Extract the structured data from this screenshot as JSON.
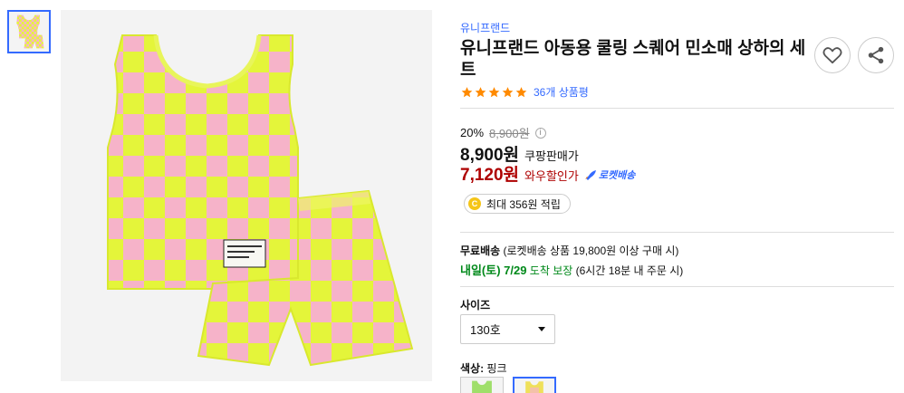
{
  "product": {
    "brand": "유니프랜드",
    "title": "유니프랜드 아동용 쿨링 스퀘어 민소매 상하의 세트",
    "rating_stars": 5,
    "review_count": "36개 상품평"
  },
  "icons": {
    "wishlist": "heart-icon",
    "share": "share-icon",
    "info": "info-icon",
    "coin": "coin-icon",
    "rocket": "rocket-icon",
    "caret": "caret-down-icon"
  },
  "pricing": {
    "discount_rate": "20%",
    "original_price": "8,900원",
    "info_glyph": "i",
    "sale_price": "8,900원",
    "sale_label": "쿠팡판매가",
    "wow_price": "7,120원",
    "wow_label": "와우할인가",
    "rocket_badge": "로켓배송"
  },
  "cashback": {
    "coin_glyph": "C",
    "text": "최대 356원 적립"
  },
  "shipping": {
    "free_label": "무료배송",
    "free_condition": "(로켓배송 상품 19,800원 이상 구매 시)",
    "arrival_date": "내일(토) 7/29",
    "arrival_label": "도착 보장",
    "arrival_condition": "(6시간 18분 내 주문 시)"
  },
  "options": {
    "size_label": "사이즈",
    "size_selected": "130호",
    "color_label": "색상:",
    "color_value": "핑크"
  },
  "colors": {
    "accent": "#346aff",
    "wow_red": "#ae0000",
    "arrival_green": "#00891a",
    "check_yellow": "#e4f53a",
    "check_pink": "#f6b3c9"
  }
}
